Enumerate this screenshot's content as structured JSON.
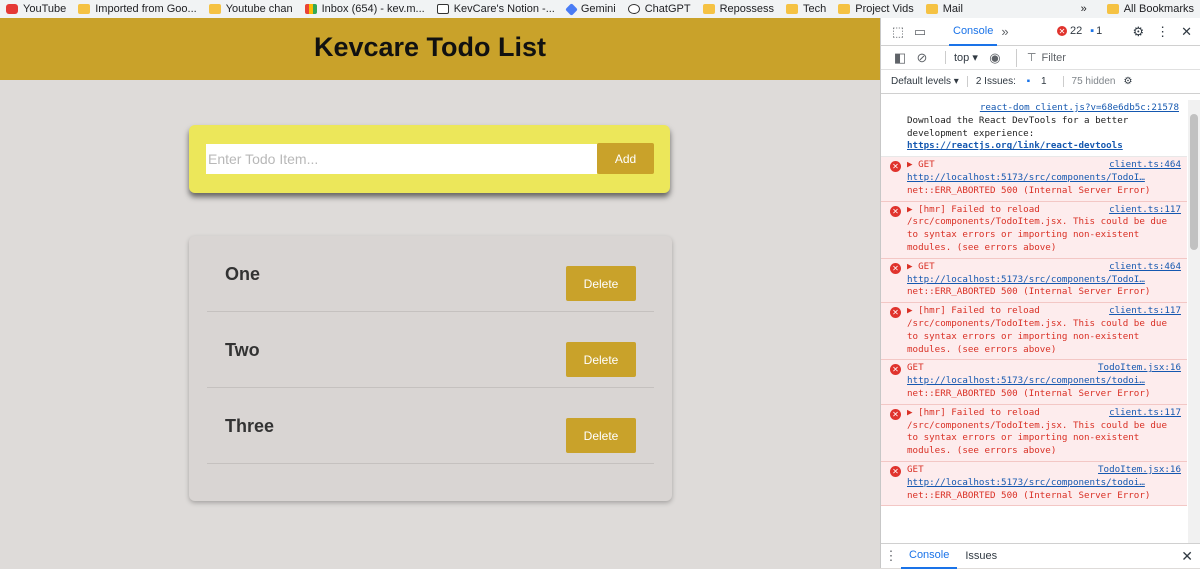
{
  "bookmarks": {
    "items": [
      {
        "label": "YouTube",
        "icon": "youtube-icon"
      },
      {
        "label": "Imported from Goo...",
        "icon": "folder-icon"
      },
      {
        "label": "Youtube chan",
        "icon": "folder-icon"
      },
      {
        "label": "Inbox (654) - kev.m...",
        "icon": "gmail-icon"
      },
      {
        "label": "KevCare's Notion -...",
        "icon": "notion-icon"
      },
      {
        "label": "Gemini",
        "icon": "gemini-icon"
      },
      {
        "label": "ChatGPT",
        "icon": "chatgpt-icon"
      },
      {
        "label": "Repossess",
        "icon": "folder-icon"
      },
      {
        "label": "Tech",
        "icon": "folder-icon"
      },
      {
        "label": "Project Vids",
        "icon": "folder-icon"
      },
      {
        "label": "Mail",
        "icon": "folder-icon"
      }
    ],
    "overflow": "»",
    "all_bookmarks": "All Bookmarks"
  },
  "app": {
    "title": "Kevcare Todo List",
    "input_placeholder": "Enter Todo Item...",
    "add_label": "Add",
    "todos": [
      {
        "text": "One",
        "delete_label": "Delete"
      },
      {
        "text": "Two",
        "delete_label": "Delete"
      },
      {
        "text": "Three",
        "delete_label": "Delete"
      }
    ],
    "colors": {
      "header": "#c9a22a",
      "input_card": "#ece75a",
      "button": "#c9a22a",
      "background": "#dedbd9"
    }
  },
  "devtools": {
    "tab_console": "Console",
    "more": "»",
    "error_count": "22",
    "message_count": "1",
    "context": "top ▾",
    "filter_placeholder": "Filter",
    "levels": "Default levels ▾",
    "issues": "2 Issues:",
    "issues_count": "1",
    "hidden": "75 hidden",
    "info": {
      "src": "react-dom_client.js?v=68e6db5c:21578",
      "text": "Download the React DevTools for a better development experience:",
      "link": "https://reactjs.org/link/react-devtools"
    },
    "errors": [
      {
        "head": "▶ GET",
        "src": "client.ts:464",
        "line1": "http://localhost:5173/src/components/TodoI…",
        "line2": "net::ERR_ABORTED 500 (Internal Server Error)"
      },
      {
        "head": "▶ [hmr] Failed to reload",
        "src": "client.ts:117",
        "line1": "/src/components/TodoItem.jsx. This could be due to syntax errors or importing non-existent modules. (see errors above)",
        "line2": ""
      },
      {
        "head": "▶ GET",
        "src": "client.ts:464",
        "line1": "http://localhost:5173/src/components/TodoI…",
        "line2": "net::ERR_ABORTED 500 (Internal Server Error)"
      },
      {
        "head": "▶ [hmr] Failed to reload",
        "src": "client.ts:117",
        "line1": "/src/components/TodoItem.jsx. This could be due to syntax errors or importing non-existent modules. (see errors above)",
        "line2": ""
      },
      {
        "head": "GET",
        "src": "TodoItem.jsx:16",
        "line1": "http://localhost:5173/src/components/todoi…",
        "line2": "net::ERR_ABORTED 500 (Internal Server Error)"
      },
      {
        "head": "▶ [hmr] Failed to reload",
        "src": "client.ts:117",
        "line1": "/src/components/TodoItem.jsx. This could be due to syntax errors or importing non-existent modules. (see errors above)",
        "line2": ""
      },
      {
        "head": "GET",
        "src": "TodoItem.jsx:16",
        "line1": "http://localhost:5173/src/components/todoi…",
        "line2": "net::ERR_ABORTED 500 (Internal Server Error)"
      }
    ],
    "bottom_tabs": [
      "Console",
      "Issues"
    ]
  }
}
